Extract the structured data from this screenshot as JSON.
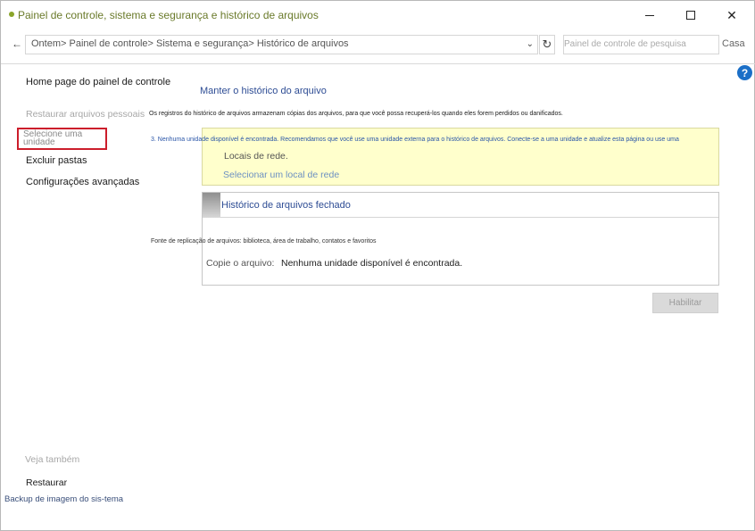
{
  "window": {
    "title": "Painel de controle, sistema e segurança e histórico de arquivos",
    "buttons": {
      "minimize": "",
      "maximize": "",
      "close": "✕"
    }
  },
  "address_bar": {
    "breadcrumb": "Ontem> Painel de controle> Sistema e segurança> Histórico de arquivos",
    "chevron": "⌄",
    "refresh": "↻",
    "search_placeholder": "Painel de controle de pesquisa",
    "search_extra": "Casa"
  },
  "sidebar": {
    "home": "Home page do painel de controle",
    "restore_personal": "Restaurar arquivos pessoais",
    "select_drive": "Selecione uma unidade",
    "exclude_folders": "Excluir pastas",
    "advanced_settings": "Configurações avançadas",
    "see_also": "Veja também",
    "restore": "Restaurar",
    "system_image_backup": "Backup de imagem do sis-tema"
  },
  "main": {
    "heading": "Manter o histórico do arquivo",
    "description": "Os registros do histórico de arquivos armazenam cópias dos arquivos, para que você possa recuperá-los quando eles forem perdidos ou danificados.",
    "warning": "3. Nenhuma unidade disponível é encontrada. Recomendamos que você use uma unidade externa para o histórico de arquivos. Conecte-se a uma unidade e atualize esta página ou use uma",
    "network_label": "Locais de rede.",
    "network_link": "Selecionar um local de rede",
    "status_title": "Histórico de arquivos fechado",
    "source_text": "Fonte de replicação de arquivos: biblioteca, área de trabalho, contatos e favoritos",
    "copy_label": "Copie o arquivo:",
    "copy_value": "Nenhuma unidade disponível é encontrada.",
    "enable_button": "Habilitar"
  },
  "help": {
    "label": "?"
  },
  "colors": {
    "accent": "#2d4c94",
    "warning_bg": "#ffffcc",
    "highlight_border": "#cc1d2b",
    "help_bg": "#1b6fc7"
  }
}
